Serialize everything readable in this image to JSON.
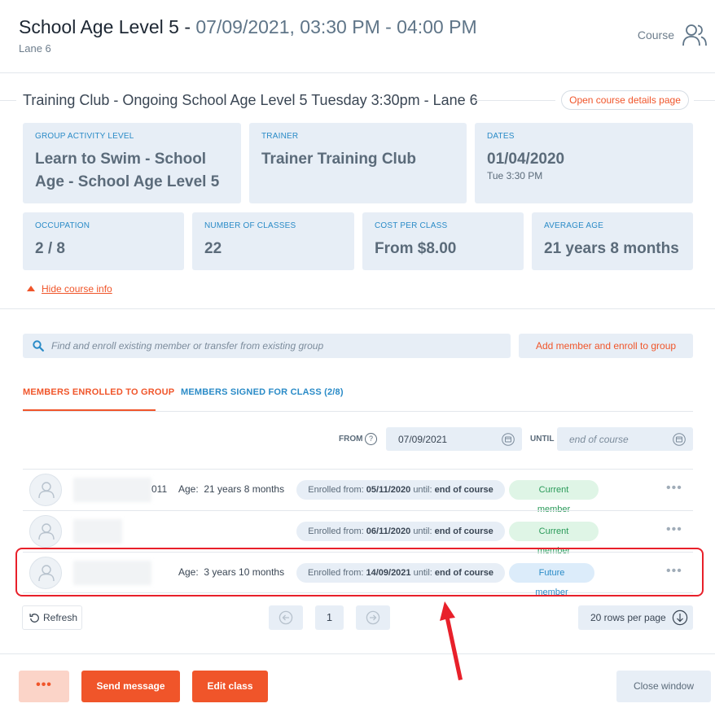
{
  "header": {
    "title": "School Age Level 5",
    "title_sep": " - ",
    "datetime": "07/09/2021, 03:30 PM - 04:00 PM",
    "subtitle": "Lane 6",
    "course_link": "Course",
    "course_icon": "people-icon"
  },
  "course": {
    "title": "Training Club - Ongoing School Age Level 5 Tuesday 3:30pm - Lane 6",
    "open_details_label": "Open course details page",
    "cards_row1": [
      {
        "label": "GROUP ACTIVITY LEVEL",
        "value": "Learn to Swim - School Age - School Age Level 5",
        "sub": ""
      },
      {
        "label": "TRAINER",
        "value": "Trainer Training Club",
        "sub": ""
      },
      {
        "label": "DATES",
        "value": "01/04/2020",
        "sub": "Tue 3:30 PM"
      }
    ],
    "cards_row2": [
      {
        "label": "OCCUPATION",
        "value": "2 / 8"
      },
      {
        "label": "NUMBER OF CLASSES",
        "value": "22"
      },
      {
        "label": "COST PER CLASS",
        "value": "From $8.00"
      },
      {
        "label": "AVERAGE AGE",
        "value": "21 years 8 months"
      }
    ],
    "hide_info_label": "Hide course info"
  },
  "search": {
    "placeholder": "Find and enroll existing member or transfer from existing group",
    "add_member_label": "Add member and enroll to group"
  },
  "tabs": {
    "enrolled": "MEMBERS ENROLLED TO GROUP",
    "signed": "MEMBERS SIGNED FOR CLASS (2/8)"
  },
  "filters": {
    "from_label": "FROM",
    "help": "?",
    "from_value": "07/09/2021",
    "until_label": "UNTIL",
    "until_placeholder": "end of course"
  },
  "members": [
    {
      "name_tail": "011",
      "age_label": "Age:",
      "age": "21 years 8 months",
      "enrolled_from_label": "Enrolled from:",
      "enrolled_from": "05/11/2020",
      "until_label": "until:",
      "until": "end of course",
      "status": "Current member",
      "status_kind": "current"
    },
    {
      "name_tail": "",
      "age_label": "",
      "age": "",
      "enrolled_from_label": "Enrolled from:",
      "enrolled_from": "06/11/2020",
      "until_label": "until:",
      "until": "end of course",
      "status": "Current member",
      "status_kind": "current"
    },
    {
      "name_tail": "",
      "age_label": "Age:",
      "age": "3 years 10 months",
      "enrolled_from_label": "Enrolled from:",
      "enrolled_from": "14/09/2021",
      "until_label": "until:",
      "until": "end of course",
      "status": "Future member",
      "status_kind": "future"
    }
  ],
  "row_menu": "•••",
  "pagination": {
    "refresh_label": "Refresh",
    "page": "1",
    "rows_per_page": "20 rows per page"
  },
  "footer": {
    "more_label": "•••",
    "send_message_label": "Send message",
    "edit_class_label": "Edit class",
    "close_window_label": "Close window"
  },
  "colors": {
    "accent": "#f0552a",
    "link_blue": "#2a8bc7",
    "card_bg": "#e7eef6",
    "annotation_red": "#e8202a"
  }
}
